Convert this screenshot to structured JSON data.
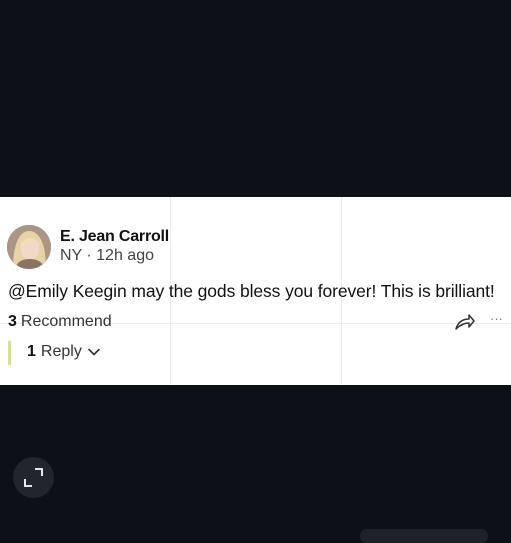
{
  "comment": {
    "author": "E. Jean Carroll",
    "location_time": "NY · 12h ago",
    "body": "@Emily Keegin may the gods bless you forever!  This is brilliant!",
    "recommend_count": "3",
    "recommend_label": "Recommend",
    "reply_count": "1",
    "reply_label": "Reply",
    "reply_bar_color": "#d9dd9b"
  },
  "icons": {
    "share": "share-arrow-icon",
    "more": "more-dots-icon",
    "more_glyph": "···",
    "expand": "expand-icon",
    "chevron": "chevron-down-icon"
  },
  "colors": {
    "background": "#0d1017",
    "card": "#ffffff",
    "text": "#111111"
  }
}
